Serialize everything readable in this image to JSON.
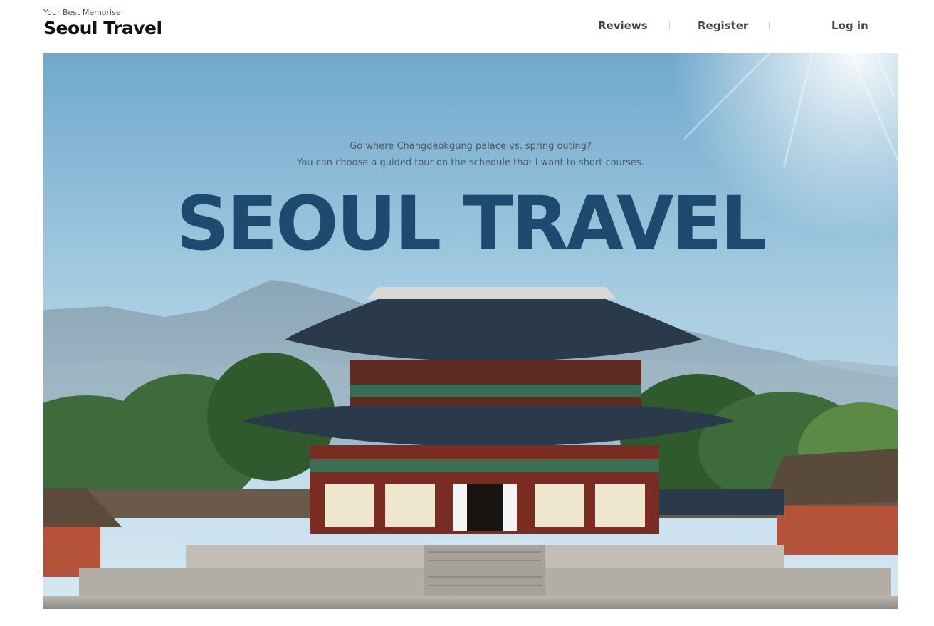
{
  "brand": {
    "tagline": "Your Best Memorise",
    "name": "Seoul Travel"
  },
  "nav": {
    "reviews": "Reviews",
    "register": "Register",
    "login": "Log in"
  },
  "hero": {
    "subtitle_line1": "Go where Changdeokgung palace vs. spring outing?",
    "subtitle_line2": "You can choose a guided tour on the schedule that I want to short courses.",
    "title": "SEOUL TRAVEL"
  },
  "colors": {
    "title": "#1f4a6f",
    "sky_top": "#6fa9cc",
    "roof": "#2a3a4a",
    "wall": "#7a2b22"
  }
}
